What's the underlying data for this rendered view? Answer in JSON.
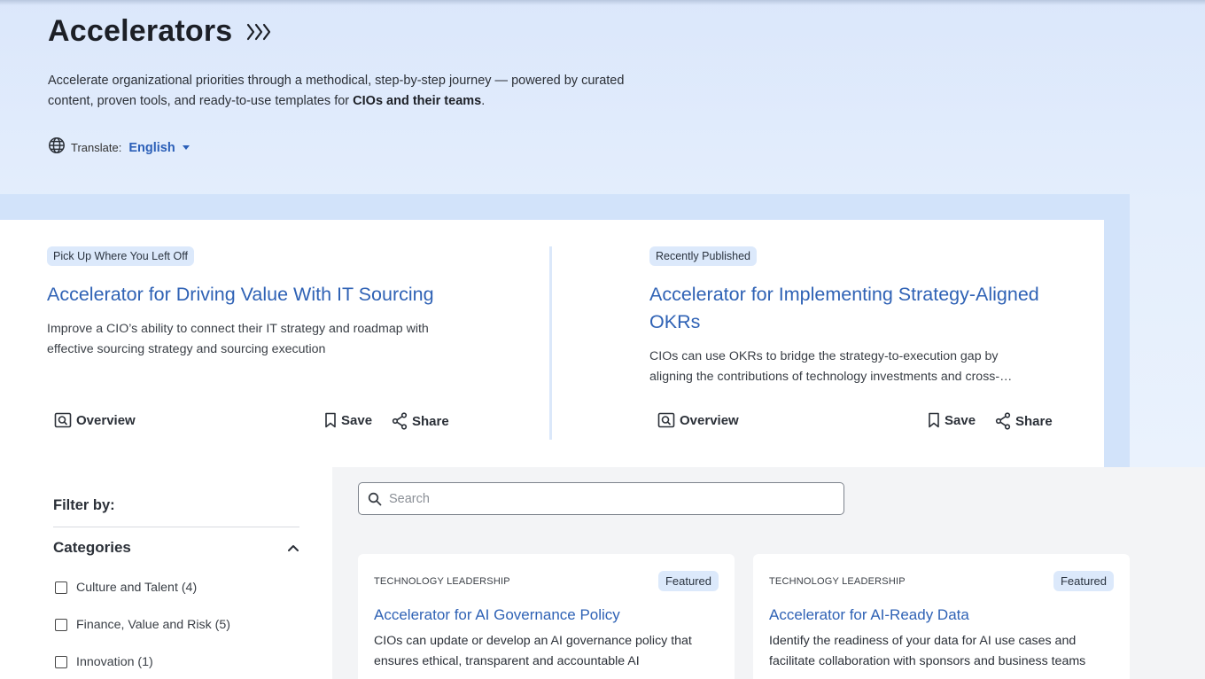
{
  "hero": {
    "title": "Accelerators",
    "description_pre": "Accelerate organizational priorities through a methodical, step-by-step journey — powered by curated content, proven tools, and ready-to-use templates for ",
    "description_bold": "CIOs and their teams",
    "description_post": ".",
    "translate_label": "Translate:",
    "language": "English"
  },
  "featured": [
    {
      "badge": "Pick Up Where You Left Off",
      "title": "Accelerator for Driving Value With IT Sourcing",
      "description": "Improve a CIO’s ability to connect their IT strategy and roadmap with effective sourcing strategy and sourcing execution",
      "overview_label": "Overview",
      "save_label": "Save",
      "share_label": "Share"
    },
    {
      "badge": "Recently Published",
      "title": "Accelerator for Implementing Strategy-Aligned OKRs",
      "description": "CIOs can use OKRs to bridge the strategy-to-execution gap by aligning the contributions of technology investments and cross-…",
      "overview_label": "Overview",
      "save_label": "Save",
      "share_label": "Share"
    }
  ],
  "filters": {
    "title": "Filter by:",
    "categories_title": "Categories",
    "items": [
      {
        "label": "Culture and Talent (4)"
      },
      {
        "label": "Finance, Value and Risk (5)"
      },
      {
        "label": "Innovation (1)"
      }
    ]
  },
  "search": {
    "placeholder": "Search"
  },
  "results": [
    {
      "category": "TECHNOLOGY LEADERSHIP",
      "badge": "Featured",
      "title": "Accelerator for AI Governance Policy",
      "description": "CIOs can update or develop an AI governance policy that ensures ethical, transparent and accountable AI"
    },
    {
      "category": "TECHNOLOGY LEADERSHIP",
      "badge": "Featured",
      "title": "Accelerator for AI-Ready Data",
      "description": "Identify the readiness of your data for AI use cases and facilitate collaboration with sponsors and business teams"
    }
  ],
  "colors": {
    "accent": "#2f62b5",
    "badge_bg": "#dce9fb",
    "hero_bg": "#e4eefc"
  }
}
